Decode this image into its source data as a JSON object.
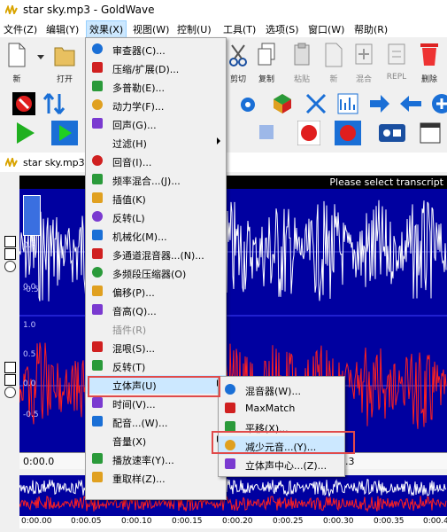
{
  "window": {
    "title": "star sky.mp3 - GoldWave"
  },
  "menubar": {
    "items": [
      "文件(Z)",
      "编辑(Y)",
      "效果(X)",
      "视图(W)",
      "控制(U)",
      "工具(T)",
      "选项(S)",
      "窗口(W)",
      "帮助(R)"
    ],
    "active": "效果(X)"
  },
  "toolbar": {
    "row1_labels": {
      "new": "新",
      "open": "打开",
      "cut": "剪切",
      "copy": "复制",
      "paste": "粘贴",
      "new2": "新",
      "mix": "混合",
      "repl": "REPL",
      "delete": "删除"
    }
  },
  "document": {
    "title": "star sky.mp3",
    "transcript_hint": "Please select transcript"
  },
  "wave": {
    "axis_top": [
      "0.5",
      "0.0",
      "-0.5"
    ],
    "axis_bottom": [
      "1.0",
      "0.5",
      "0.0",
      "-0.5"
    ],
    "ruler_start": "0:00.0",
    "ruler_partial": ".3",
    "overview_ticks": [
      "0:00.00",
      "0:00.05",
      "0:00.10",
      "0:00.15",
      "0:00.20",
      "0:00.25",
      "0:00.30",
      "0:00.35",
      "0:00.4"
    ]
  },
  "effects_menu": {
    "items": [
      {
        "label": "审查器(C)...",
        "icon": "inspector-icon"
      },
      {
        "label": "压缩/扩展(D)...",
        "icon": "compress-icon"
      },
      {
        "label": "多普勒(E)...",
        "icon": "doppler-icon"
      },
      {
        "label": "动力学(F)...",
        "icon": "dynamics-icon"
      },
      {
        "label": "回声(G)...",
        "icon": "echo-icon"
      },
      {
        "label": "过滤(H)",
        "icon": "",
        "submenu": true
      },
      {
        "label": "回音(I)...",
        "icon": "reverb-icon"
      },
      {
        "label": "频率混合...(J)...",
        "icon": "freq-mix-icon"
      },
      {
        "label": "插值(K)",
        "icon": "interpolate-icon"
      },
      {
        "label": "反转(L)",
        "icon": "invert-icon"
      },
      {
        "label": "机械化(M)...",
        "icon": "mechanize-icon"
      },
      {
        "label": "多通道混音器...(N)...",
        "icon": "channel-mixer-icon"
      },
      {
        "label": "多频段压缩器(O)",
        "icon": "multiband-icon"
      },
      {
        "label": "偏移(P)...",
        "icon": "offset-icon"
      },
      {
        "label": "音高(Q)...",
        "icon": "pitch-icon"
      },
      {
        "label": "插件(R)",
        "icon": "",
        "disabled": true
      },
      {
        "label": "混哏(S)...",
        "icon": "playback-rate-icon"
      },
      {
        "label": "反转(T)",
        "icon": "reverse-icon"
      },
      {
        "label": "立体声(U)",
        "icon": "",
        "submenu": true,
        "highlight": true
      },
      {
        "label": "时间(V)...",
        "icon": "time-icon"
      },
      {
        "label": "配音...(W)...",
        "icon": "voice-icon"
      },
      {
        "label": "音量(X)",
        "icon": "",
        "submenu": true
      },
      {
        "label": "播放速率(Y)...",
        "icon": "hz-icon"
      },
      {
        "label": "重取样(Z)...",
        "icon": "resample-icon"
      }
    ]
  },
  "stereo_submenu": {
    "items": [
      {
        "label": "混音器(W)...",
        "icon": "mixer-icon"
      },
      {
        "label": "MaxMatch",
        "icon": "maxmatch-icon"
      },
      {
        "label": "平移(X)...",
        "icon": "pan-icon"
      },
      {
        "label": "减少元音...(Y)...",
        "icon": "reduce-vocals-icon",
        "highlight": true
      },
      {
        "label": "立体声中心...(Z)...",
        "icon": "stereo-center-icon"
      }
    ]
  }
}
